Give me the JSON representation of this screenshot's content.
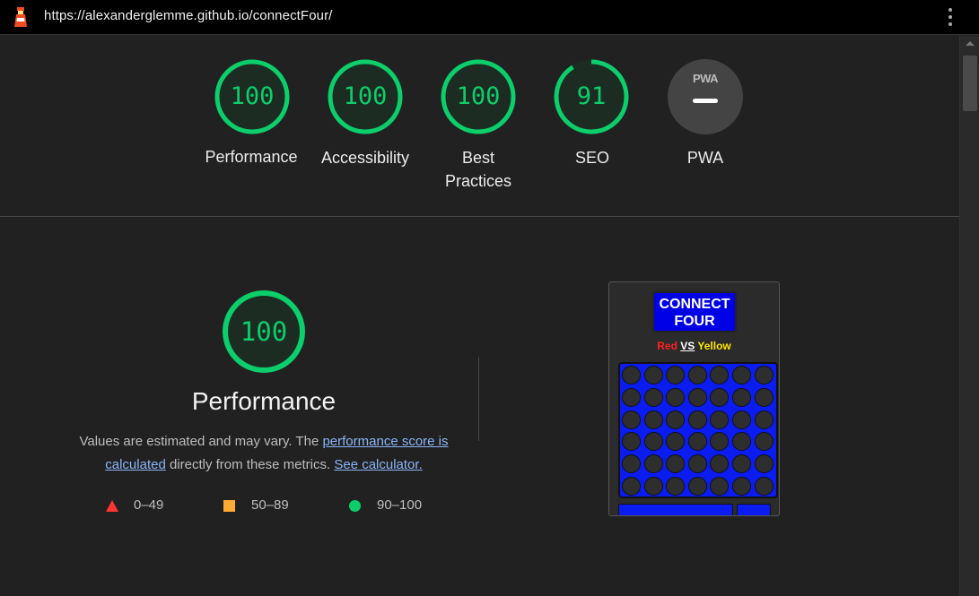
{
  "browser": {
    "url": "https://alexanderglemme.github.io/connectFour/"
  },
  "colors": {
    "pass": "#0cce6b",
    "average": "#ffaa33",
    "fail": "#ff3333",
    "link": "#8ab4f8"
  },
  "categories": [
    {
      "label": "Performance",
      "score": "100",
      "score_fraction": 1.0
    },
    {
      "label": "Accessibility",
      "score": "100",
      "score_fraction": 1.0
    },
    {
      "label": "Best",
      "label_line2": "Practices",
      "score": "100",
      "score_fraction": 1.0
    },
    {
      "label": "SEO",
      "score": "91",
      "score_fraction": 0.91
    },
    {
      "label": "PWA",
      "badge_text": "PWA",
      "icon": "pwa-dash-icon"
    }
  ],
  "performance": {
    "score": "100",
    "score_fraction": 1.0,
    "title": "Performance",
    "desc_prefix": "Values are estimated and may vary. The ",
    "link_score": "performance score is calculated",
    "desc_middle": " directly from these metrics. ",
    "link_calc": "See calculator.",
    "legend": [
      {
        "range": "0–49",
        "icon": "red-triangle-icon"
      },
      {
        "range": "50–89",
        "icon": "orange-square-icon"
      },
      {
        "range": "90–100",
        "icon": "green-circle-icon"
      }
    ]
  },
  "thumbnail": {
    "title_line1": "CONNECT",
    "title_line2": "FOUR",
    "red": "Red",
    "vs": "VS",
    "yellow": "Yellow",
    "rows": 6,
    "cols": 7
  }
}
